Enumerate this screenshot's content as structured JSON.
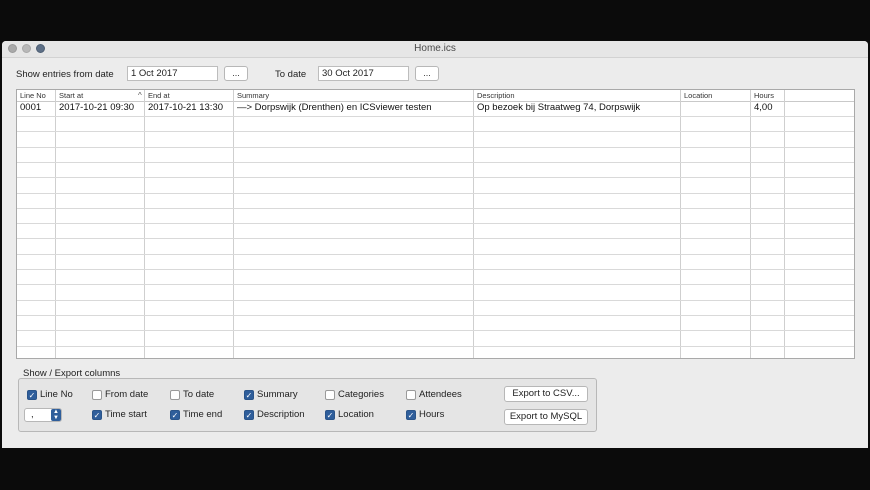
{
  "window": {
    "title": "Home.ics"
  },
  "filters": {
    "from_label": "Show entries from date",
    "from_value": "1 Oct 2017",
    "from_button": "...",
    "to_label": "To date",
    "to_value": "30 Oct 2017",
    "to_button": "..."
  },
  "table": {
    "columns": [
      "Line No",
      "Start at",
      "End at",
      "Summary",
      "Description",
      "Location",
      "Hours"
    ],
    "sort_indicator": "^",
    "rows": [
      {
        "line_no": "0001",
        "start_at": "2017-10-21 09:30",
        "end_at": "2017-10-21 13:30",
        "summary": "—> Dorpswijk (Drenthen) en ICSviewer testen",
        "description": "Op bezoek bij Straatweg 74, Dorpswijk",
        "location": "",
        "hours": "4,00"
      }
    ]
  },
  "columns_panel": {
    "title": "Show / Export columns",
    "checkboxes": {
      "line_no": {
        "label": "Line No",
        "checked": true
      },
      "from_date": {
        "label": "From date",
        "checked": false
      },
      "to_date": {
        "label": "To date",
        "checked": false
      },
      "summary": {
        "label": "Summary",
        "checked": true
      },
      "categories": {
        "label": "Categories",
        "checked": false
      },
      "attendees": {
        "label": "Attendees",
        "checked": false
      },
      "time_start": {
        "label": "Time start",
        "checked": true
      },
      "time_end": {
        "label": "Time end",
        "checked": true
      },
      "description": {
        "label": "Description",
        "checked": true
      },
      "location": {
        "label": "Location",
        "checked": true
      },
      "hours": {
        "label": "Hours",
        "checked": true
      }
    },
    "separator_value": ",",
    "export_csv": "Export to CSV...",
    "export_mysql": "Export to MySQL"
  },
  "colors": {
    "accent": "#2f5e9b",
    "window_bg": "#ececec"
  }
}
